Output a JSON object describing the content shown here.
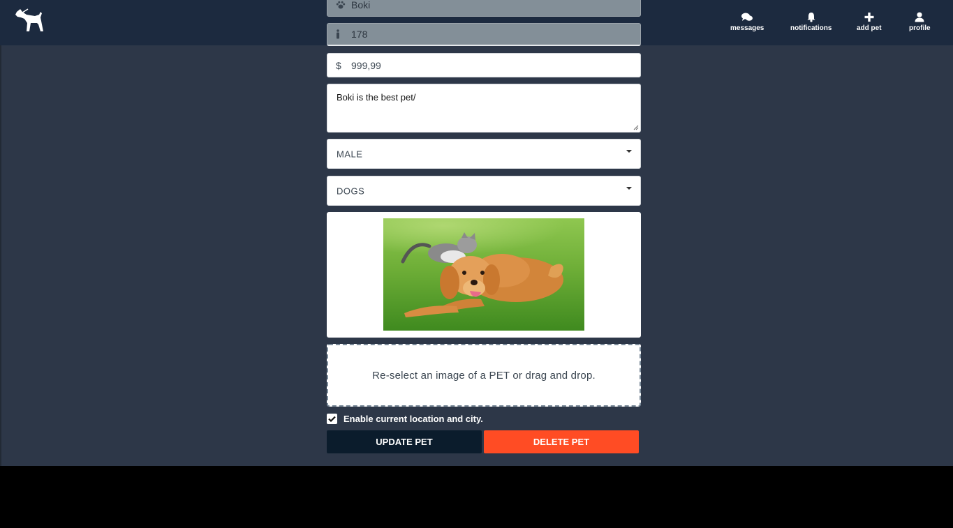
{
  "nav": {
    "logo_icon": "dog-icon",
    "items": [
      {
        "label": "messages",
        "icon": "chat-bubbles-icon"
      },
      {
        "label": "notifications",
        "icon": "bell-icon"
      },
      {
        "label": "add pet",
        "icon": "plus-icon"
      },
      {
        "label": "profile",
        "icon": "user-icon"
      }
    ]
  },
  "form": {
    "name": {
      "value": "Boki",
      "icon": "paw-icon",
      "disabled": true
    },
    "age": {
      "value": "178",
      "icon": "person-icon",
      "disabled": true
    },
    "price": {
      "value": "999,99",
      "icon_glyph": "$"
    },
    "description": {
      "value": "Boki is the best pet/"
    },
    "gender": {
      "selected": "MALE"
    },
    "category": {
      "selected": "DOGS"
    },
    "dropzone_text": "Re-select an image of a PET or drag and drop.",
    "location_checkbox": {
      "label": "Enable current location and city.",
      "checked": true
    },
    "update_label": "UPDATE PET",
    "delete_label": "DELETE PET"
  },
  "colors": {
    "navbar": "#1c2a3f",
    "background": "#2d3748",
    "update_button": "#0b1c2c",
    "delete_button": "#ff4c24"
  }
}
